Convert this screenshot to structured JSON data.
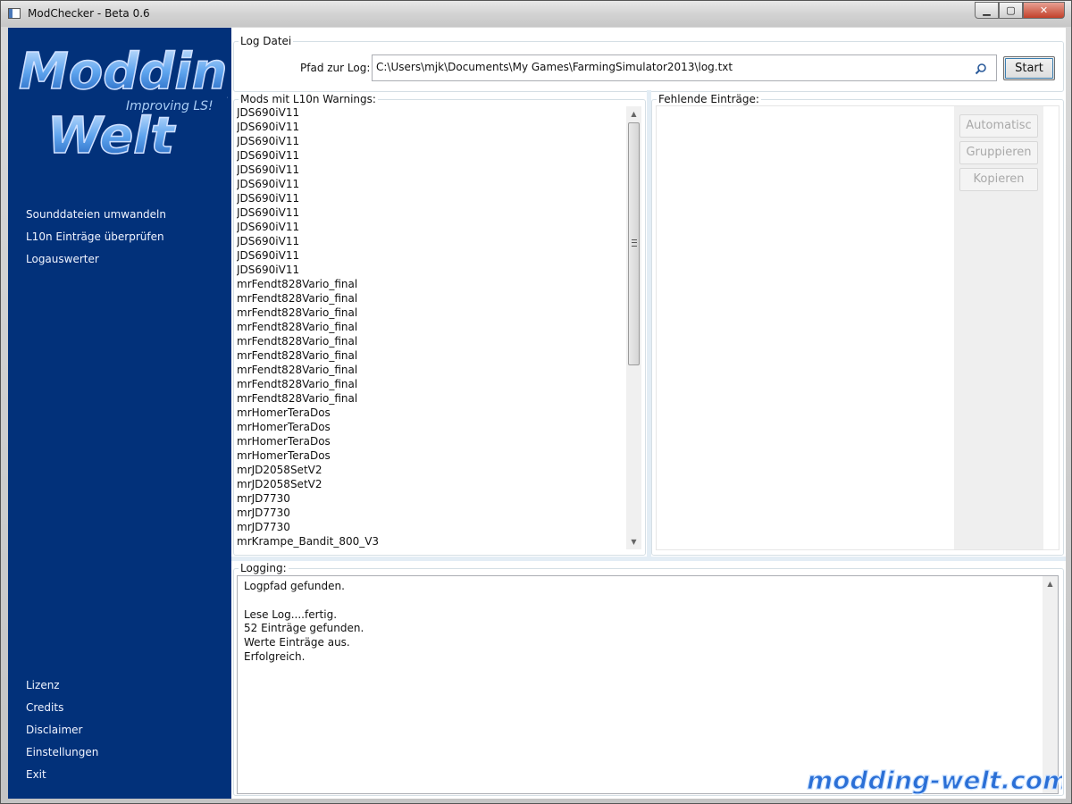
{
  "window": {
    "title": "ModChecker - Beta 0.6",
    "min_label": "▁",
    "max_label": "▢",
    "close_label": "✕"
  },
  "logo": {
    "line1": "Modding",
    "line2": "Welt",
    "tagline": "Improving LS!"
  },
  "sidebar": {
    "top_items": [
      "Sounddateien umwandeln",
      "L10n Einträge überprüfen",
      "Logauswerter"
    ],
    "bottom_items": [
      "Lizenz",
      "Credits",
      "Disclaimer",
      "Einstellungen",
      "Exit"
    ]
  },
  "log_group": {
    "title": "Log Datei",
    "path_label": "Pfad zur Log:",
    "path_value": "C:\\Users\\mjk\\Documents\\My Games\\FarmingSimulator2013\\log.txt",
    "start_label": "Start"
  },
  "mods_group": {
    "title": "Mods mit L10n Warnings:",
    "items": [
      "JDS690iV11",
      "JDS690iV11",
      "JDS690iV11",
      "JDS690iV11",
      "JDS690iV11",
      "JDS690iV11",
      "JDS690iV11",
      "JDS690iV11",
      "JDS690iV11",
      "JDS690iV11",
      "JDS690iV11",
      "JDS690iV11",
      "mrFendt828Vario_final",
      "mrFendt828Vario_final",
      "mrFendt828Vario_final",
      "mrFendt828Vario_final",
      "mrFendt828Vario_final",
      "mrFendt828Vario_final",
      "mrFendt828Vario_final",
      "mrFendt828Vario_final",
      "mrFendt828Vario_final",
      "mrHomerTeraDos",
      "mrHomerTeraDos",
      "mrHomerTeraDos",
      "mrHomerTeraDos",
      "mrJD2058SetV2",
      "mrJD2058SetV2",
      "mrJD7730",
      "mrJD7730",
      "mrJD7730",
      "mrKrampe_Bandit_800_V3"
    ]
  },
  "missing_group": {
    "title": "Fehlende Einträge:",
    "buttons": [
      "Automatisc",
      "Gruppieren",
      "Kopieren"
    ]
  },
  "logging_group": {
    "title": "Logging:",
    "text": "Logpfad gefunden.\n\nLese Log....fertig.\n52 Einträge gefunden.\nWerte Einträge aus.\nErfolgreich."
  },
  "watermark": "modding-welt.com",
  "colors": {
    "sidebar_bg": "#02317a",
    "sidebar_text": "#f0f4ff",
    "group_border": "#d5dfe5",
    "splitter": "#e3edf5"
  },
  "icons": {
    "search": "search-icon",
    "app": "app-icon"
  }
}
